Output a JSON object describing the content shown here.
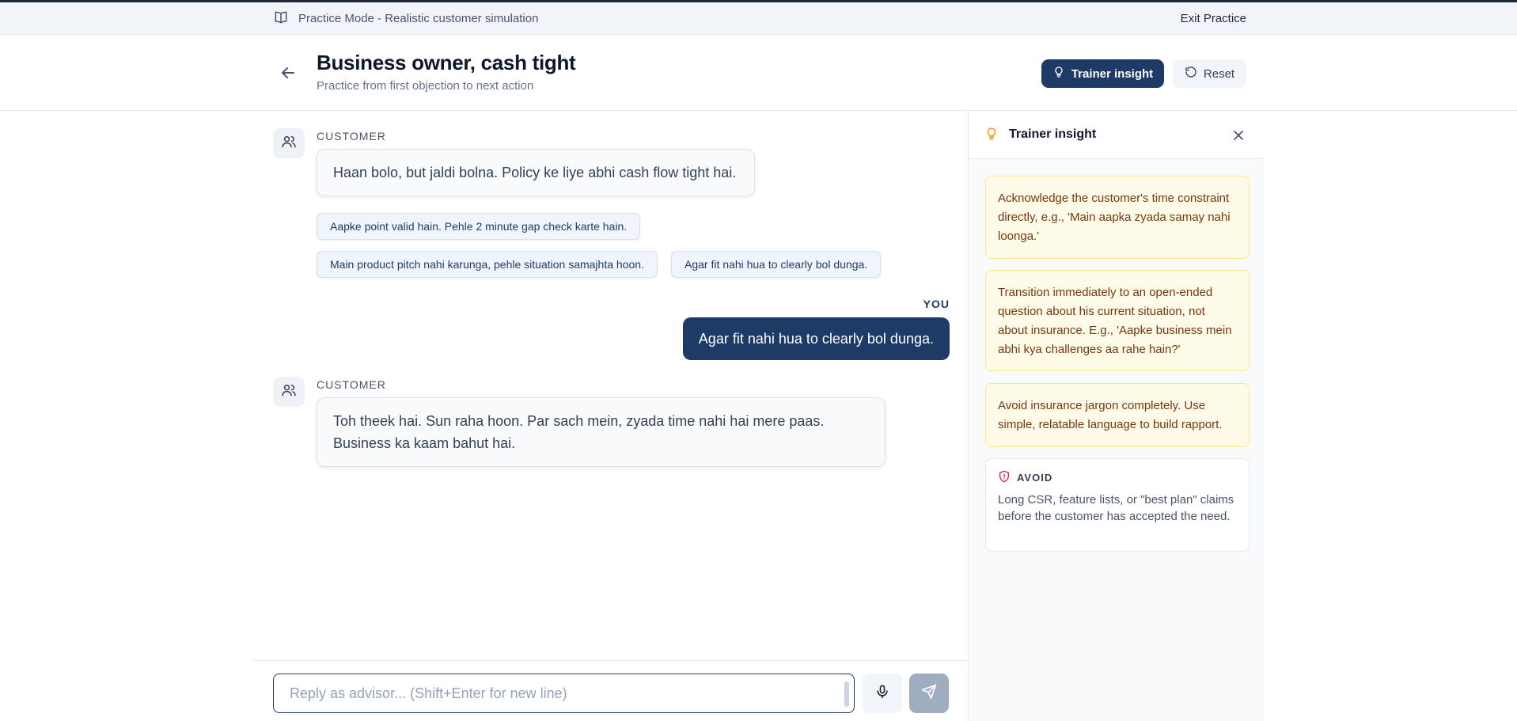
{
  "banner": {
    "mode_text": "Practice Mode - Realistic customer simulation",
    "exit_label": "Exit Practice"
  },
  "header": {
    "title": "Business owner, cash tight",
    "subtitle": "Practice from first objection to next action",
    "insight_label": "Trainer insight",
    "reset_label": "Reset"
  },
  "chat": {
    "customer_role": "CUSTOMER",
    "you_role": "YOU",
    "messages": [
      {
        "text": "Haan bolo, but jaldi bolna. Policy ke liye abhi cash flow tight hai."
      },
      {
        "text": "Agar fit nahi hua to clearly bol dunga."
      },
      {
        "text": "Toh theek hai. Sun raha hoon. Par sach mein, zyada time nahi hai mere paas. Business ka kaam bahut hai."
      }
    ],
    "suggestions": [
      "Aapke point valid hain. Pehle 2 minute gap check karte hain.",
      "Main product pitch nahi karunga, pehle situation samajhta hoon.",
      "Agar fit nahi hua to clearly bol dunga."
    ]
  },
  "input": {
    "placeholder": "Reply as advisor... (Shift+Enter for new line)",
    "value": ""
  },
  "panel": {
    "title": "Trainer insight",
    "tips": [
      "Acknowledge the customer's time constraint directly, e.g., 'Main aapka zyada samay nahi loonga.'",
      "Transition immediately to an open-ended question about his current situation, not about insurance. E.g., 'Aapke business mein abhi kya challenges aa rahe hain?'",
      "Avoid insurance jargon completely. Use simple, relatable language to build rapport."
    ],
    "avoid_label": "AVOID",
    "avoid_text": "Long CSR, feature lists, or \"best plan\" claims before the customer has accepted the need."
  },
  "colors": {
    "primary": "#1e3a66",
    "tip_bg": "#fefce8",
    "tip_text": "#78350f",
    "avoid_icon": "#e11d48",
    "bulb": "#f59e0b"
  },
  "icons": [
    "book-icon",
    "back-arrow-icon",
    "lightbulb-icon",
    "reset-icon",
    "users-icon",
    "mic-icon",
    "send-icon",
    "close-icon",
    "shield-alert-icon"
  ]
}
